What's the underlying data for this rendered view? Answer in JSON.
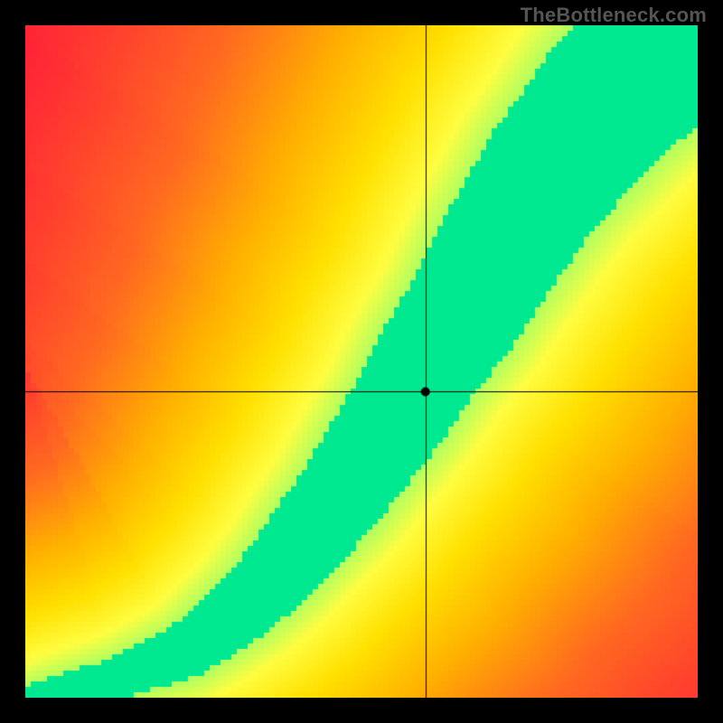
{
  "watermark": "TheBottleneck.com",
  "chart_data": {
    "type": "heatmap",
    "title": "",
    "xlabel": "",
    "ylabel": "",
    "xlim": [
      0,
      1
    ],
    "ylim": [
      0,
      1
    ],
    "marker": {
      "x": 0.595,
      "y": 0.455
    },
    "crosshair": {
      "x": 0.595,
      "y": 0.455
    },
    "optimal_curve": {
      "description": "approximate path of the green optimal band center from lower-left to upper-right",
      "points": [
        [
          0.0,
          0.0
        ],
        [
          0.04,
          0.01
        ],
        [
          0.09,
          0.02
        ],
        [
          0.14,
          0.03
        ],
        [
          0.19,
          0.05
        ],
        [
          0.24,
          0.07
        ],
        [
          0.28,
          0.1
        ],
        [
          0.33,
          0.14
        ],
        [
          0.38,
          0.19
        ],
        [
          0.42,
          0.24
        ],
        [
          0.47,
          0.3
        ],
        [
          0.51,
          0.36
        ],
        [
          0.56,
          0.43
        ],
        [
          0.6,
          0.5
        ],
        [
          0.65,
          0.57
        ],
        [
          0.69,
          0.64
        ],
        [
          0.74,
          0.72
        ],
        [
          0.78,
          0.78
        ],
        [
          0.83,
          0.84
        ],
        [
          0.87,
          0.89
        ],
        [
          0.92,
          0.94
        ],
        [
          0.96,
          0.98
        ],
        [
          1.0,
          1.0
        ]
      ]
    },
    "band_width": {
      "at_start": 0.015,
      "at_end": 0.13,
      "description": "half-width of green band in normalized units, grows from origin to upper-right"
    },
    "colorscale": [
      [
        0.0,
        "#ff173b"
      ],
      [
        0.35,
        "#ff6a20"
      ],
      [
        0.55,
        "#ffb000"
      ],
      [
        0.72,
        "#ffe000"
      ],
      [
        0.85,
        "#fffd40"
      ],
      [
        0.93,
        "#b0ff60"
      ],
      [
        1.0,
        "#00e890"
      ]
    ]
  }
}
